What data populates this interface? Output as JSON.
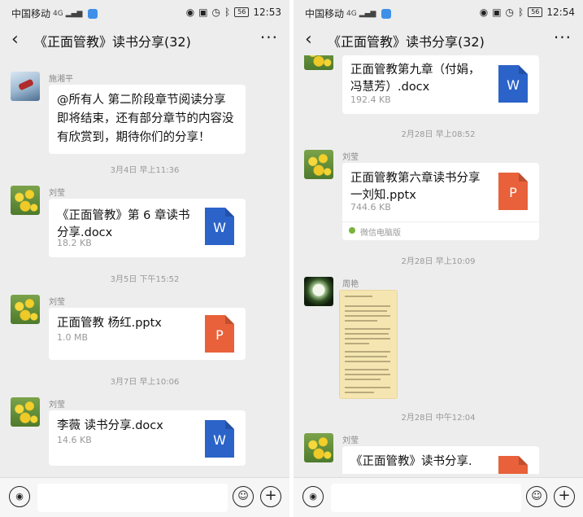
{
  "status_left": {
    "carrier": "中国移动",
    "network": "4G",
    "time": "12:53"
  },
  "status_right": {
    "carrier": "中国移动",
    "network": "4G",
    "time": "12:54"
  },
  "battery": "56",
  "chat_title": "《正面管教》读书分享(32)",
  "icons": {
    "back": "‹",
    "more": "···",
    "voice": "◉",
    "emoji": "☺",
    "plus": "+",
    "batt_icon": "battery-icon"
  },
  "left": {
    "msg1": {
      "sender": "施湘平",
      "text": "@所有人 第二阶段章节阅读分享即将结束，还有部分章节的内容没有欣赏到，期待你们的分享！"
    },
    "time1": "3月4日 早上11:36",
    "msg2": {
      "sender": "刘莹",
      "file": "《正面管教》第 6 章读书分享.docx",
      "size": "18.2 KB",
      "type": "W"
    },
    "time2": "3月5日 下午15:52",
    "msg3": {
      "sender": "刘莹",
      "file": "正面管教 杨红.pptx",
      "size": "1.0 MB",
      "type": "P"
    },
    "time3": "3月7日 早上10:06",
    "msg4": {
      "sender": "刘莹",
      "file": "李薇 读书分享.docx",
      "size": "14.6 KB",
      "type": "W"
    }
  },
  "right": {
    "msg1": {
      "file": "正面管教第九章（付娟，冯慧芳）.docx",
      "size": "192.4 KB",
      "type": "W"
    },
    "time1": "2月28日 早上08:52",
    "msg2": {
      "sender": "刘莹",
      "file": "正面管教第六章读书分享一刘知.pptx",
      "size": "744.6 KB",
      "type": "P",
      "source": "微信电脑版"
    },
    "time2": "2月28日 早上10:09",
    "msg3": {
      "sender": "周艳"
    },
    "time3": "2月28日 中午12:04",
    "msg4": {
      "sender": "刘莹",
      "file": "《正面管教》读书分享."
    }
  }
}
